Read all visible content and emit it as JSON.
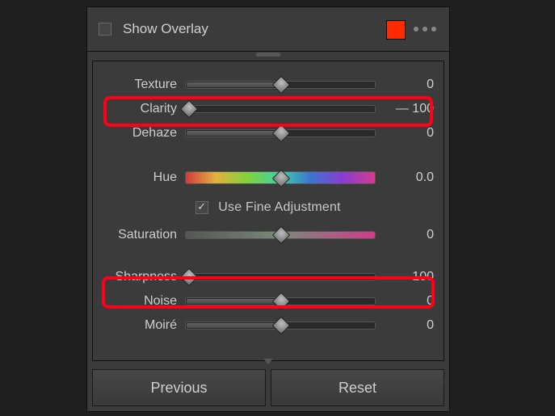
{
  "topbar": {
    "show_overlay_label": "Show Overlay",
    "show_overlay_checked": false,
    "swatch_color": "#ff2a00"
  },
  "sliders": {
    "texture": {
      "label": "Texture",
      "value": "0",
      "pos": 50
    },
    "clarity": {
      "label": "Clarity",
      "value": "— 100",
      "pos": 0
    },
    "dehaze": {
      "label": "Dehaze",
      "value": "0",
      "pos": 50
    },
    "hue": {
      "label": "Hue",
      "value": "0.0",
      "pos": 50
    },
    "saturation": {
      "label": "Saturation",
      "value": "0",
      "pos": 50
    },
    "sharpness": {
      "label": "Sharpness",
      "value": "— 100",
      "pos": 0
    },
    "noise": {
      "label": "Noise",
      "value": "0",
      "pos": 50
    },
    "moire": {
      "label": "Moiré",
      "value": "0",
      "pos": 50
    }
  },
  "fine": {
    "label": "Use Fine Adjustment",
    "checked": true
  },
  "buttons": {
    "previous": "Previous",
    "reset": "Reset"
  }
}
